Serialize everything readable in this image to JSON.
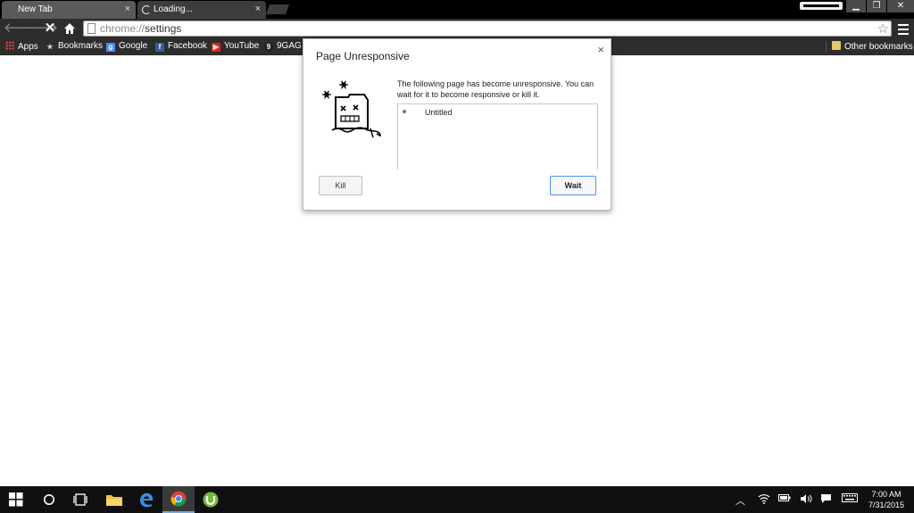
{
  "browser": {
    "tabs": [
      {
        "title": "New Tab",
        "close": "×"
      },
      {
        "title": "Loading...",
        "close": "×"
      }
    ],
    "address": {
      "scheme": "chrome://",
      "rest": "settings"
    },
    "bookmarks": [
      {
        "label": "Apps",
        "icon": "apps-icon"
      },
      {
        "label": "Bookmarks",
        "icon": "star-icon"
      },
      {
        "label": "Google",
        "icon": "google-icon"
      },
      {
        "label": "Facebook",
        "icon": "facebook-icon"
      },
      {
        "label": "YouTube",
        "icon": "youtube-icon"
      },
      {
        "label": "9GAG -",
        "icon": "9gag-icon"
      }
    ],
    "other_bookmarks": "Other bookmarks"
  },
  "dialog": {
    "title": "Page Unresponsive",
    "close": "×",
    "message": "The following page has become unresponsive. You can wait for it to become responsive or kill it.",
    "pages": [
      "Untitled"
    ],
    "kill_label": "Kill",
    "wait_label": "Wait"
  },
  "taskbar": {
    "time": "7:00 AM",
    "date": "7/31/2015"
  },
  "colors": {
    "chrome_dark": "#2d2d2d",
    "taskbar": "#101010",
    "focus_blue": "#4d90fe"
  }
}
